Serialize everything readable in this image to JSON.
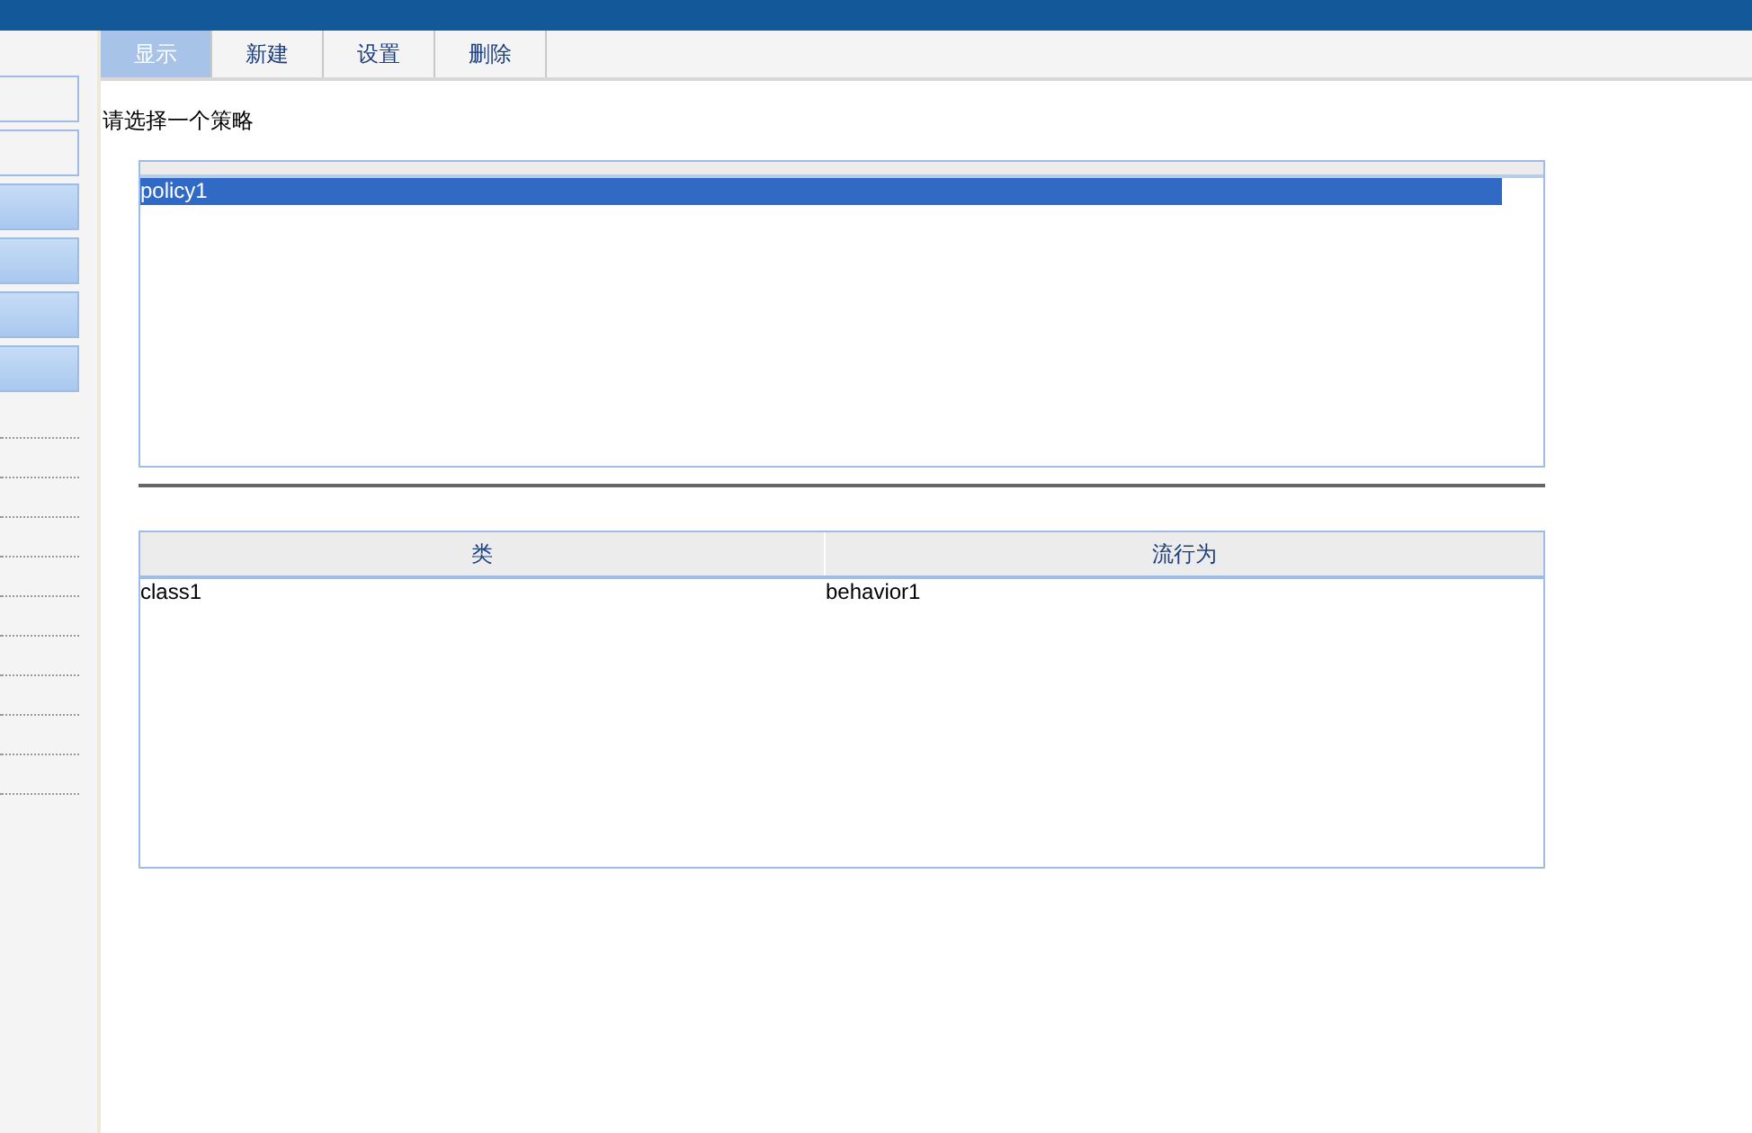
{
  "sidebar": {
    "items": [
      {
        "kind": "plain"
      },
      {
        "kind": "plain"
      },
      {
        "kind": "raised"
      },
      {
        "kind": "raised"
      },
      {
        "kind": "raised"
      },
      {
        "kind": "raised"
      },
      {
        "kind": "row"
      },
      {
        "kind": "row"
      },
      {
        "kind": "row"
      },
      {
        "kind": "row"
      },
      {
        "kind": "row"
      },
      {
        "kind": "row"
      },
      {
        "kind": "row"
      },
      {
        "kind": "row"
      },
      {
        "kind": "row"
      },
      {
        "kind": "row"
      }
    ]
  },
  "tabs": [
    {
      "label": "显示",
      "selected": true
    },
    {
      "label": "新建",
      "selected": false
    },
    {
      "label": "设置",
      "selected": false
    },
    {
      "label": "删除",
      "selected": false
    }
  ],
  "prompt": "请选择一个策略",
  "policies": [
    {
      "label": "policy1",
      "selected": true
    }
  ],
  "table": {
    "columns": [
      "类",
      "流行为"
    ],
    "rows": [
      [
        "class1",
        "behavior1"
      ]
    ]
  }
}
